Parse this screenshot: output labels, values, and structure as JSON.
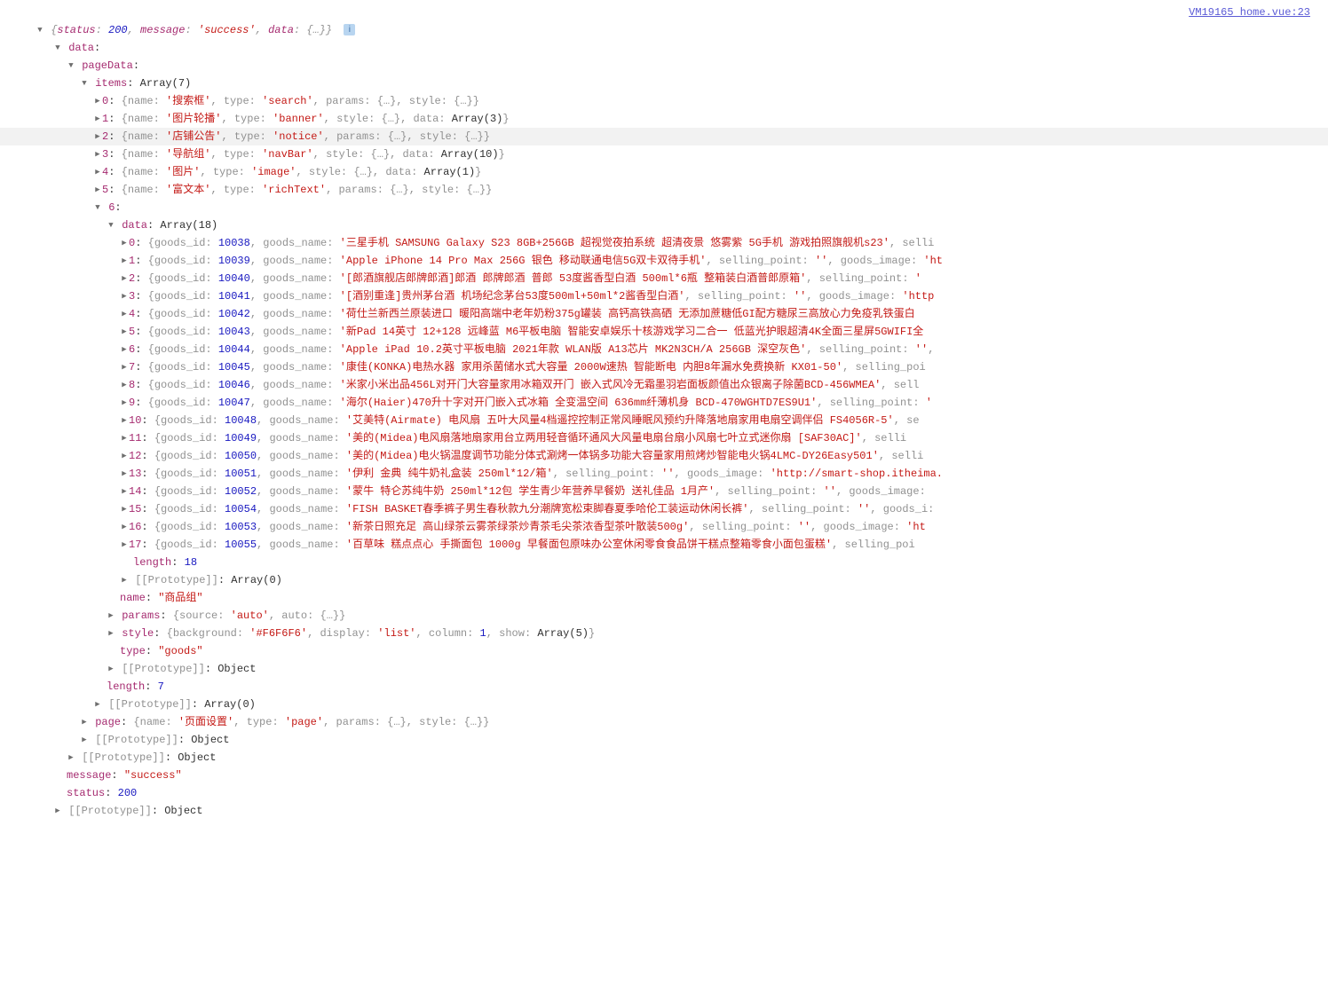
{
  "source_link": "VM19165 home.vue:23",
  "summary_line": {
    "k_status": "status",
    "v_status": "200",
    "k_message": "message",
    "v_message": "'success'",
    "k_data": "data",
    "ell": "{…}"
  },
  "data_label": "data",
  "pageData_label": "pageData",
  "items_label": "items",
  "items_array_text": "Array(7)",
  "items": [
    {
      "idx": "0",
      "name": "'搜索框'",
      "type": "'search'",
      "params": "{…}",
      "style": "{…}"
    },
    {
      "idx": "1",
      "name": "'图片轮播'",
      "type": "'banner'",
      "style": "{…}",
      "data_arr": "Array(3)"
    },
    {
      "idx": "2",
      "name": "'店铺公告'",
      "type": "'notice'",
      "params": "{…}",
      "style": "{…}"
    },
    {
      "idx": "3",
      "name": "'导航组'",
      "type": "'navBar'",
      "style": "{…}",
      "data_arr": "Array(10)"
    },
    {
      "idx": "4",
      "name": "'图片'",
      "type": "'image'",
      "style": "{…}",
      "data_arr": "Array(1)"
    },
    {
      "idx": "5",
      "name": "'富文本'",
      "type": "'richText'",
      "params": "{…}",
      "style": "{…}"
    }
  ],
  "labels": {
    "name": "name",
    "type": "type",
    "params": "params",
    "style": "style",
    "data": "data",
    "goods_id": "goods_id",
    "goods_name": "goods_name",
    "selling_point": "selling_point",
    "goods_image": "goods_image",
    "length": "length",
    "proto": "[[Prototype]]",
    "source": "source",
    "auto": "auto",
    "background": "background",
    "display": "display",
    "column": "column",
    "show": "show",
    "message": "message",
    "status": "status"
  },
  "item6_idx": "6",
  "item6_data_label": "data",
  "item6_data_array_text": "Array(18)",
  "goods": [
    {
      "idx": "0",
      "id": "10038",
      "name": "'三星手机 SAMSUNG Galaxy S23 8GB+256GB 超视觉夜拍系统 超清夜景 悠雾紫 5G手机 游戏拍照旗舰机s23'",
      "tail": ", selli"
    },
    {
      "idx": "1",
      "id": "10039",
      "name": "'Apple iPhone 14 Pro Max 256G 银色 移动联通电信5G双卡双待手机'",
      "sp": "''",
      "tail_key": "goods_image",
      "tail_val": "'ht"
    },
    {
      "idx": "2",
      "id": "10040",
      "name": "'[郎酒旗舰店郎牌郎酒]郎酒 郎牌郎酒 普郎 53度酱香型白酒 500ml*6瓶 整箱装白酒普郎原箱'",
      "tail_key": "selling_point",
      "tail_val": "'"
    },
    {
      "idx": "3",
      "id": "10041",
      "name": "'[酒别重逢]贵州茅台酒 机场纪念茅台53度500ml+50ml*2酱香型白酒'",
      "sp": "''",
      "tail_key": "goods_image",
      "tail_val": "'http"
    },
    {
      "idx": "4",
      "id": "10042",
      "name": "'荷仕兰新西兰原装进口 暖阳高端中老年奶粉375g罐装 高钙高铁高硒 无添加蔗糖低GI配方糖尿三高放心力免疫乳铁蛋白"
    },
    {
      "idx": "5",
      "id": "10043",
      "name": "'新Pad 14英寸 12+128 远峰蓝 M6平板电脑 智能安卓娱乐十核游戏学习二合一 低蓝光护眼超清4K全面三星屏5GWIFI全"
    },
    {
      "idx": "6",
      "id": "10044",
      "name": "'Apple iPad 10.2英寸平板电脑 2021年款 WLAN版 A13芯片 MK2N3CH/A 256GB 深空灰色'",
      "sp": "''",
      "tail": ","
    },
    {
      "idx": "7",
      "id": "10045",
      "name": "'康佳(KONKA)电热水器 家用杀菌储水式大容量 2000W速热 智能断电 内胆8年漏水免费换新 KX01-50'",
      "tail": ", selling_poi"
    },
    {
      "idx": "8",
      "id": "10046",
      "name": "'米家小米出品456L对开门大容量家用冰箱双开门 嵌入式风冷无霜墨羽岩面板颜值出众银离子除菌BCD-456WMEA'",
      "tail": ", sell"
    },
    {
      "idx": "9",
      "id": "10047",
      "name": "'海尔(Haier)470升十字对开门嵌入式冰箱 全变温空间 636mm纤薄机身 BCD-470WGHTD7ES9U1'",
      "tail_key": "selling_point",
      "tail_val": "'"
    },
    {
      "idx": "10",
      "id": "10048",
      "name": "'艾美特(Airmate) 电风扇 五叶大风量4档遥控控制正常风睡眠风预约升降落地扇家用电扇空调伴侣 FS4056R-5'",
      "tail": ", se"
    },
    {
      "idx": "11",
      "id": "10049",
      "name": "'美的(Midea)电风扇落地扇家用台立两用轻音循环通风大风量电扇台扇小风扇七叶立式迷你扇 [SAF30AC]'",
      "tail": ", selli"
    },
    {
      "idx": "12",
      "id": "10050",
      "name": "'美的(Midea)电火锅温度调节功能分体式涮烤一体锅多功能大容量家用煎烤炒智能电火锅4LMC-DY26Easy501'",
      "tail": ", selli"
    },
    {
      "idx": "13",
      "id": "10051",
      "name": "'伊利 金典 纯牛奶礼盒装 250ml*12/箱'",
      "sp": "''",
      "tail_key": "goods_image",
      "tail_val": "'http://smart-shop.itheima."
    },
    {
      "idx": "14",
      "id": "10052",
      "name": "'蒙牛 特仑苏纯牛奶 250ml*12包 学生青少年营养早餐奶 送礼佳品 1月产'",
      "sp": "''",
      "tail_key": "goods_image",
      "tail_val": ""
    },
    {
      "idx": "15",
      "id": "10054",
      "name": "'FISH BASKET春季裤子男生春秋款九分潮牌宽松束脚春夏季哈伦工装运动休闲长裤'",
      "sp": "''",
      "tail_key": "goods_i",
      "tail_val": ""
    },
    {
      "idx": "16",
      "id": "10053",
      "name": "'新茶日照充足 高山绿茶云雾茶绿茶炒青茶毛尖茶浓香型茶叶散装500g'",
      "sp": "''",
      "tail_key": "goods_image",
      "tail_val": "'ht"
    },
    {
      "idx": "17",
      "id": "10055",
      "name": "'百草味 糕点点心 手撕面包 1000g 早餐面包原味办公室休闲零食食品饼干糕点整箱零食小面包蛋糕'",
      "tail": ", selling_poi"
    }
  ],
  "item6_length": "18",
  "item6_proto_arr": "Array(0)",
  "item6_name_val": "\"商品组\"",
  "item6_params": {
    "source": "'auto'",
    "auto": "{…}"
  },
  "item6_style": {
    "background": "'#F6F6F6'",
    "display": "'list'",
    "column": "1",
    "show": "Array(5)"
  },
  "item6_type_val": "\"goods\"",
  "item6_proto_obj": "Object",
  "items_length": "7",
  "items_proto": "Array(0)",
  "page_entry": {
    "key": "page",
    "name": "'页面设置'",
    "type": "'page'",
    "params": "{…}",
    "style": "{…}"
  },
  "pageData_proto": "Object",
  "data_proto": "Object",
  "message_val": "\"success\"",
  "status_val": "200",
  "root_proto": "Object"
}
